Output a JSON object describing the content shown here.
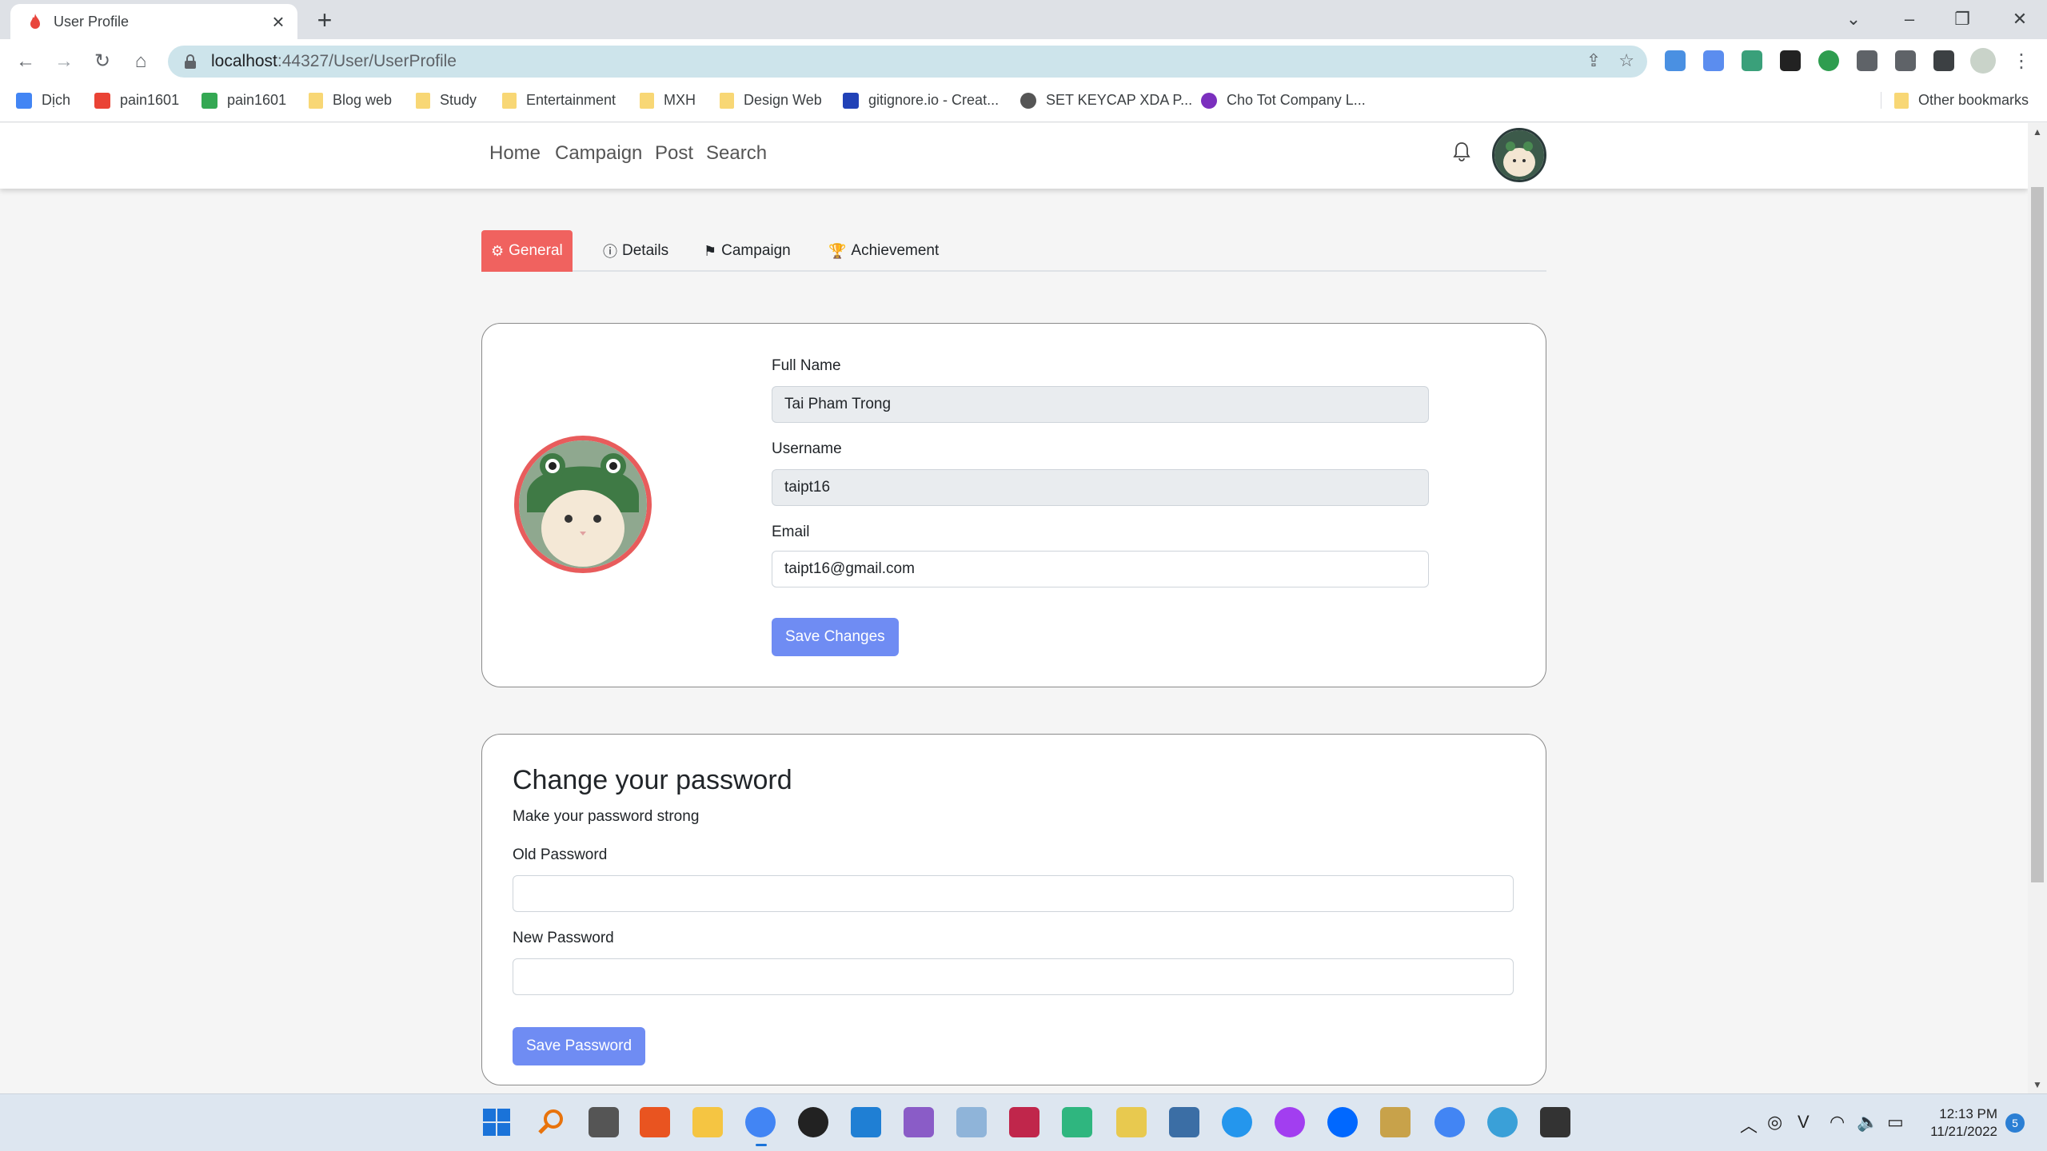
{
  "browser": {
    "tab_title": "User Profile",
    "url_host": "localhost",
    "url_path": ":44327/User/UserProfile"
  },
  "bookmarks": [
    {
      "label": "Dịch",
      "icon": "translate-icon",
      "color": "#4285f4"
    },
    {
      "label": "pain1601",
      "icon": "gmail-icon",
      "color": "#ea4335"
    },
    {
      "label": "pain1601",
      "icon": "drive-icon",
      "color": "#34a853"
    },
    {
      "label": "Blog web",
      "icon": "folder-icon",
      "color": "#f8d775"
    },
    {
      "label": "Study",
      "icon": "folder-icon",
      "color": "#f8d775"
    },
    {
      "label": "Entertainment",
      "icon": "folder-icon",
      "color": "#f8d775"
    },
    {
      "label": "MXH",
      "icon": "folder-icon",
      "color": "#f8d775"
    },
    {
      "label": "Design Web",
      "icon": "folder-icon",
      "color": "#f8d775"
    },
    {
      "label": "gitignore.io - Creat...",
      "icon": "gitignore-icon",
      "color": "#2142b7"
    },
    {
      "label": "SET KEYCAP XDA P...",
      "icon": "keycap-icon",
      "color": "#555555"
    },
    {
      "label": "Cho Tot Company L...",
      "icon": "chotot-icon",
      "color": "#7b2fbe"
    }
  ],
  "other_bookmarks": "Other bookmarks",
  "site_nav": {
    "links": [
      "Home",
      "Campaign",
      "Post",
      "Search"
    ]
  },
  "profile_tabs": [
    {
      "label": "General",
      "icon": "gear-icon",
      "active": true
    },
    {
      "label": "Details",
      "icon": "info-icon",
      "active": false
    },
    {
      "label": "Campaign",
      "icon": "flag-icon",
      "active": false
    },
    {
      "label": "Achievement",
      "icon": "trophy-icon",
      "active": false
    }
  ],
  "general_form": {
    "full_name_label": "Full Name",
    "full_name_value": "Tai Pham Trong",
    "username_label": "Username",
    "username_value": "taipt16",
    "email_label": "Email",
    "email_value": "taipt16@gmail.com",
    "save_label": "Save Changes"
  },
  "password_form": {
    "title": "Change your password",
    "subtitle": "Make your password strong",
    "old_label": "Old Password",
    "old_value": "",
    "new_label": "New Password",
    "new_value": "",
    "save_label": "Save Password"
  },
  "taskbar": {
    "time": "12:13 PM",
    "date": "11/21/2022",
    "notifications": "5"
  },
  "colors": {
    "accent_tab": "#f0625f",
    "button": "#6f8cf3",
    "avatar_border": "#e85c5c"
  }
}
